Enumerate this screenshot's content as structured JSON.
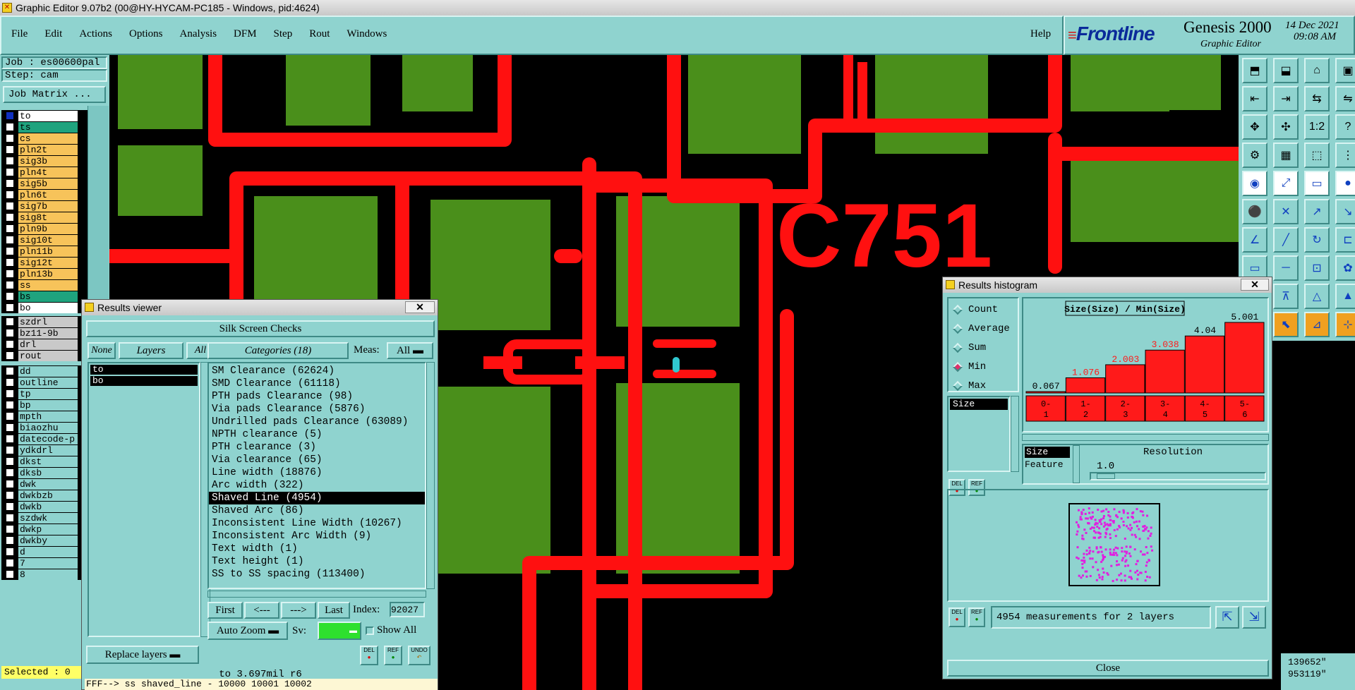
{
  "window": {
    "title": "Graphic Editor 9.07b2 (00@HY-HYCAM-PC185 - Windows, pid:4624)"
  },
  "menu": [
    "File",
    "Edit",
    "Actions",
    "Options",
    "Analysis",
    "DFM",
    "Step",
    "Rout",
    "Windows"
  ],
  "help": "Help",
  "brand": {
    "logo": "Frontline",
    "product": "Genesis 2000",
    "subtitle": "Graphic Editor",
    "date": "14 Dec 2021",
    "time": "09:08 AM"
  },
  "job": {
    "job": "Job : es00600pal",
    "step": "Step: cam",
    "matrix_btn": "Job Matrix ..."
  },
  "layers_top": [
    {
      "name": "to",
      "color": "#ffffff"
    },
    {
      "name": "ts",
      "color": "#1fa37e"
    },
    {
      "name": "cs",
      "color": "#f7c35a"
    },
    {
      "name": "pln2t",
      "color": "#f7c35a"
    },
    {
      "name": "sig3b",
      "color": "#f7c35a"
    },
    {
      "name": "pln4t",
      "color": "#f7c35a"
    },
    {
      "name": "sig5b",
      "color": "#f7c35a"
    },
    {
      "name": "pln6t",
      "color": "#f7c35a"
    },
    {
      "name": "sig7b",
      "color": "#f7c35a"
    },
    {
      "name": "sig8t",
      "color": "#f7c35a"
    },
    {
      "name": "pln9b",
      "color": "#f7c35a"
    },
    {
      "name": "sig10t",
      "color": "#f7c35a"
    },
    {
      "name": "pln11b",
      "color": "#f7c35a"
    },
    {
      "name": "sig12t",
      "color": "#f7c35a"
    },
    {
      "name": "pln13b",
      "color": "#f7c35a"
    },
    {
      "name": "ss",
      "color": "#f7c35a"
    },
    {
      "name": "bs",
      "color": "#1fa37e"
    },
    {
      "name": "bo",
      "color": "#ffffff"
    }
  ],
  "layers_drill": [
    {
      "name": "szdrl",
      "color": "#c9c9c9"
    },
    {
      "name": "bz11-9b",
      "color": "#c9c9c9"
    },
    {
      "name": "drl",
      "color": "#c9c9c9"
    },
    {
      "name": "rout",
      "color": "#c9c9c9"
    }
  ],
  "layers_misc": [
    "dd",
    "outline",
    "tp",
    "bp",
    "mpth",
    "biaozhu",
    "datecode-p",
    "ydkdrl",
    "dkst",
    "dksb",
    "dwk",
    "dwkbzb",
    "dwkb",
    "szdwk",
    "dwkp",
    "dwkby",
    "d",
    "7",
    "8"
  ],
  "selected": "Selected : 0",
  "results_viewer": {
    "title": "Results viewer",
    "header": "Silk Screen Checks",
    "none": "None",
    "layers": "Layers",
    "all": "All",
    "layer_list": [
      "to",
      "bo"
    ],
    "categories_btn": "Categories (18)",
    "meas_label": "Meas:",
    "meas_value": "All",
    "categories": [
      "SM Clearance (62624)",
      "SMD Clearance (61118)",
      "PTH pads Clearance (98)",
      "Via pads Clearance (5876)",
      "Undrilled pads Clearance (63089)",
      "NPTH clearance (5)",
      "PTH clearance (3)",
      "Via clearance (65)",
      "Line width (18876)",
      "Arc width (322)",
      "Shaved Line (4954)",
      "Shaved Arc (86)",
      "Inconsistent Line Width (10267)",
      "Inconsistent Arc Width (9)",
      "Text width (1)",
      "Text height (1)",
      "SS to SS spacing (113400)"
    ],
    "selected_index": 10,
    "first": "First",
    "prev": "<---",
    "next": "--->",
    "last": "Last",
    "index_label": "Index:",
    "index_value": "92027",
    "auto_zoom": "Auto Zoom",
    "sv_label": "Sv:",
    "show_all": "Show All",
    "replace_layers": "Replace layers",
    "status": "to 3.697mil  r6",
    "del": "DEL",
    "ref": "REF",
    "undo": "UNDO"
  },
  "console": "FFF--> ss shaved_line - 10000 10001 10002",
  "histogram": {
    "title": "Results histogram",
    "modes": [
      "Count",
      "Average",
      "Sum",
      "Min",
      "Max"
    ],
    "active_mode": "Min",
    "chart_title": "Size(Size) / Min(Size)",
    "field_list": [
      "Size"
    ],
    "resolution_fields": [
      "Size",
      "Feature"
    ],
    "resolution_label": "Resolution",
    "resolution_value": "1.0",
    "summary": "4954 measurements for 2 layers",
    "close": "Close",
    "del": "DEL",
    "ref": "REF"
  },
  "chart_data": {
    "type": "bar",
    "title": "Size(Size) / Min(Size)",
    "categories": [
      "0-1",
      "1-2",
      "2-3",
      "3-4",
      "4-5",
      "5-6"
    ],
    "values": [
      0.067,
      1.076,
      2.003,
      3.038,
      4.04,
      5.001
    ],
    "labels": [
      "0.067",
      "1.076",
      "2.003",
      "3.038",
      "4.04",
      "5.001"
    ],
    "ylim": [
      0,
      5.5
    ],
    "bar_color": "#ff1a1a",
    "label_colors": [
      "#000000",
      "#ff1a1a",
      "#ff1a1a",
      "#ff1a1a",
      "#000000",
      "#000000"
    ]
  },
  "canvas": {
    "silk_text": "C751",
    "copper": "#4a8f1b",
    "silk": "#ff1010"
  },
  "coords": {
    "x": "139652\"",
    "y": "953119\""
  }
}
